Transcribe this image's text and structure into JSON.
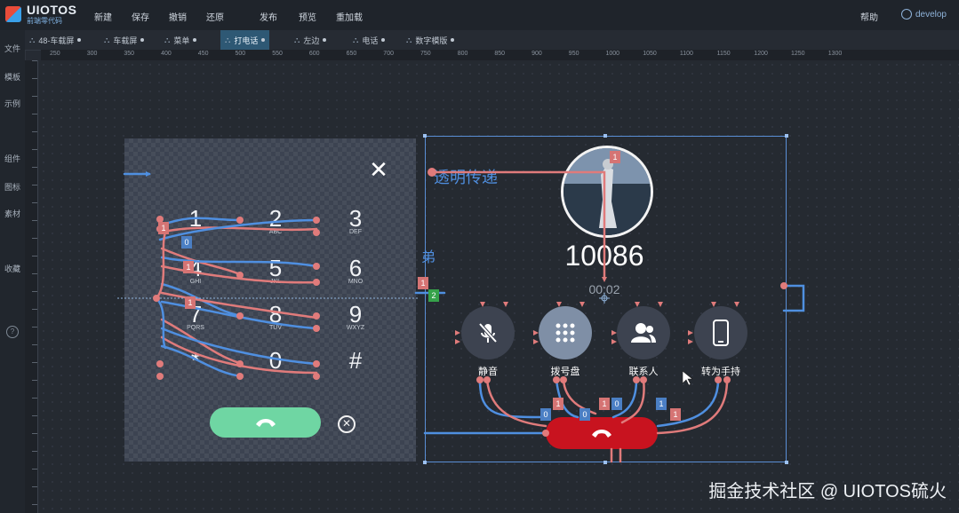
{
  "app": {
    "logo_name": "UIOTOS",
    "logo_sub": "前端零代码"
  },
  "toolbar": {
    "new": "新建",
    "save": "保存",
    "undo": "撤销",
    "redo": "还原",
    "publish": "发布",
    "preview": "预览",
    "rerun": "重加载"
  },
  "topright": {
    "help": "帮助",
    "user": "develop"
  },
  "sidebar": {
    "items": [
      "文件",
      "模板",
      "示例",
      "组件",
      "图标",
      "素材",
      "收藏"
    ],
    "help": "?"
  },
  "tabs": [
    {
      "label": "48-车载屏"
    },
    {
      "label": "车载屏"
    },
    {
      "label": "菜单"
    },
    {
      "label": "打电话",
      "active": true
    },
    {
      "label": "左边"
    },
    {
      "label": "电话"
    },
    {
      "label": "数字模版"
    }
  ],
  "ruler": {
    "ticks": [
      "250",
      "300",
      "350",
      "400",
      "450",
      "500",
      "550",
      "600",
      "650",
      "700",
      "750",
      "800",
      "850",
      "900",
      "950",
      "1000",
      "1050",
      "1100",
      "1150",
      "1200",
      "1250",
      "1300"
    ]
  },
  "dialpad": {
    "keys": [
      {
        "digit": "1",
        "sub": ""
      },
      {
        "digit": "2",
        "sub": "ABC"
      },
      {
        "digit": "3",
        "sub": "DEF"
      },
      {
        "digit": "4",
        "sub": "GHI"
      },
      {
        "digit": "5",
        "sub": "JKL"
      },
      {
        "digit": "6",
        "sub": "MNO"
      },
      {
        "digit": "7",
        "sub": "PQRS"
      },
      {
        "digit": "8",
        "sub": "TUV"
      },
      {
        "digit": "9",
        "sub": "WXYZ"
      },
      {
        "digit": "*",
        "sub": ""
      },
      {
        "digit": "0",
        "sub": ""
      },
      {
        "digit": "#",
        "sub": ""
      }
    ],
    "close": "✕",
    "clear": "✕"
  },
  "call": {
    "passthrough_label": "透明传递",
    "side_label": "弟",
    "number": "10086",
    "timer": "00:02",
    "actions": [
      {
        "label": "静音",
        "icon": "mic-off-icon"
      },
      {
        "label": "拨号盘",
        "icon": "keypad-icon",
        "active": true
      },
      {
        "label": "联系人",
        "icon": "contacts-icon"
      },
      {
        "label": "转为手持",
        "icon": "phone-device-icon"
      }
    ]
  },
  "badges": [
    "1",
    "0",
    "1",
    "1",
    "1",
    "2",
    "1",
    "0",
    "1",
    "0",
    "1",
    "0",
    "1",
    "1"
  ],
  "colors": {
    "accent": "#4f8fe0",
    "hangup": "#c8131f",
    "call": "#6fd6a3",
    "wire_red": "#e07b7b",
    "wire_blue": "#4f8fe0"
  },
  "watermark": "掘金技术社区 @ UIOTOS硫火"
}
